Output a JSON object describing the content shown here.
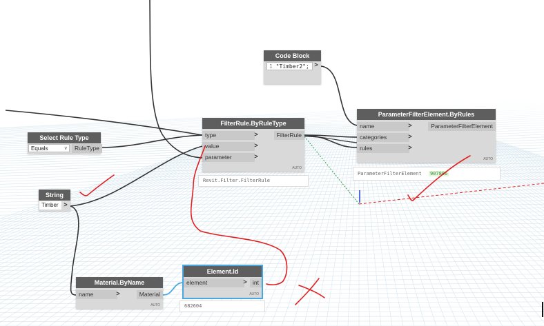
{
  "colors": {
    "accent_blue": "#4aa6e0",
    "annotation_red": "#e02020",
    "header_grey": "#5e5e5e",
    "node_body": "#d9d9d9",
    "grid": "#d6e6ef"
  },
  "nodes": {
    "code_block": {
      "title": "Code Block",
      "line_number": "1",
      "code": "\"Timber2\";",
      "out_arrow": ">"
    },
    "filter_rule": {
      "title": "FilterRule.ByRuleType",
      "inputs": [
        "type",
        "value",
        "parameter"
      ],
      "output": "FilterRule",
      "auto": "AUTO",
      "preview": "Revit.Filter.FilterRule"
    },
    "param_filter": {
      "title": "ParameterFilterElement.ByRules",
      "inputs": [
        "name",
        "categories",
        "rules"
      ],
      "output": "ParameterFilterElement",
      "auto": "AUTO",
      "preview_label": "ParameterFilterElement",
      "preview_value": "907886"
    },
    "select_rule": {
      "title": "Select Rule Type",
      "selected": "Equals",
      "output": "RuleType"
    },
    "string": {
      "title": "String",
      "value": "Timber",
      "out_arrow": ">"
    },
    "material": {
      "title": "Material.ByName",
      "input": "name",
      "output": "Material",
      "auto": "AUTO"
    },
    "element_id": {
      "title": "Element.Id",
      "input": "element",
      "output": "int",
      "auto": "AUTO",
      "preview": "682604"
    }
  },
  "arrows": {
    "in": ">",
    "dropdown": "v"
  }
}
